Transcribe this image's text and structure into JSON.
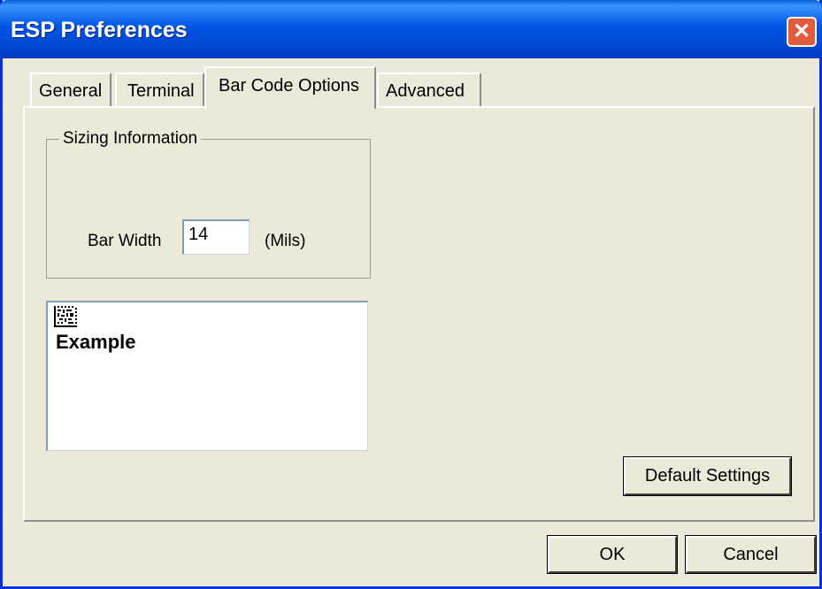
{
  "window": {
    "title": "ESP Preferences",
    "close_glyph": "✕"
  },
  "tabs": [
    {
      "label": "General",
      "active": false
    },
    {
      "label": "Terminal",
      "active": false
    },
    {
      "label": "Bar Code Options",
      "active": true
    },
    {
      "label": "Advanced",
      "active": false
    }
  ],
  "sizing": {
    "group_label": "Sizing Information",
    "bar_width_label": "Bar Width",
    "bar_width_value": "14",
    "units": "(Mils)"
  },
  "preview": {
    "text": "Example",
    "barcode_icon": "datamatrix-barcode-icon"
  },
  "buttons": {
    "default_settings": "Default Settings",
    "ok": "OK",
    "cancel": "Cancel"
  },
  "colors": {
    "title_blue": "#0055e5",
    "close_red": "#e35a3c",
    "face": "#ece9d8"
  }
}
